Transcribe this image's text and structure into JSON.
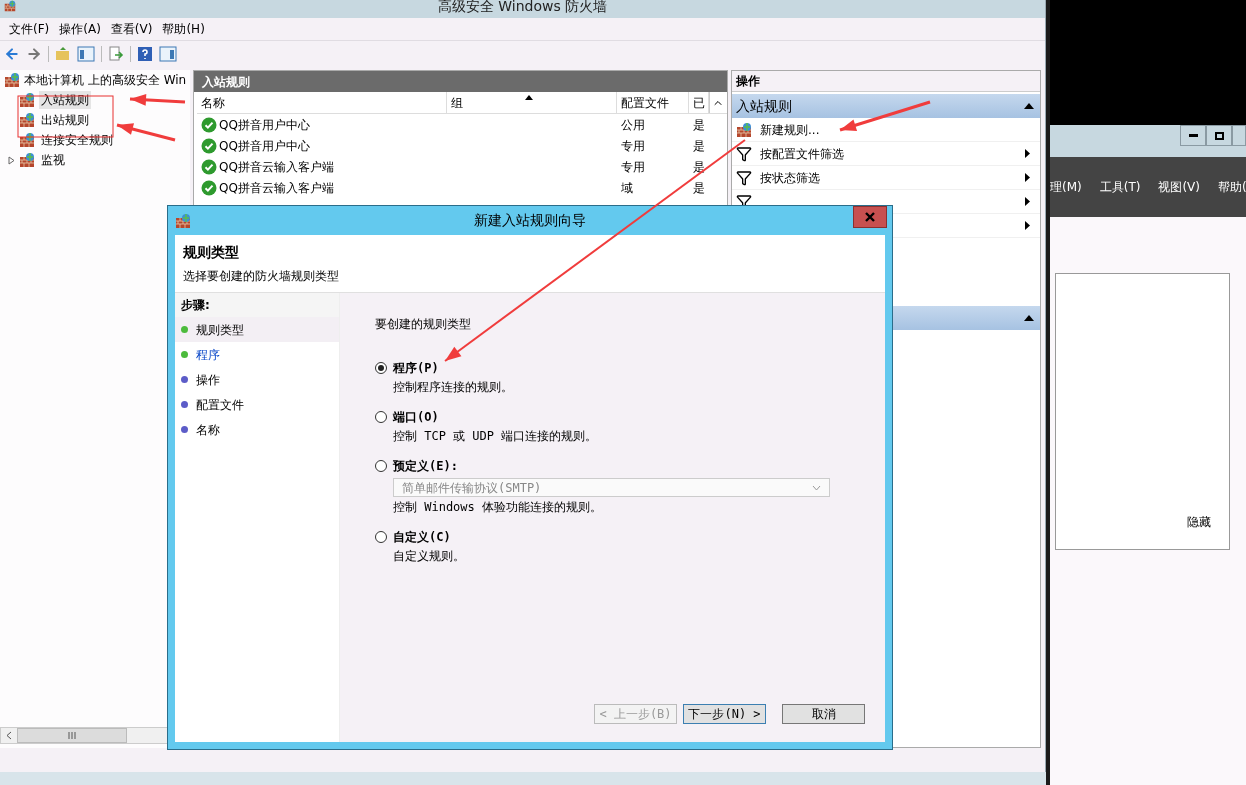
{
  "main_window": {
    "title": "高级安全 Windows 防火墙",
    "menu": [
      "文件(F)",
      "操作(A)",
      "查看(V)",
      "帮助(H)"
    ],
    "tree": {
      "root": "本地计算机 上的高级安全 Win",
      "children": [
        {
          "label": "入站规则",
          "kind": "leaf",
          "selected": true
        },
        {
          "label": "出站规则",
          "kind": "leaf",
          "selected": false
        },
        {
          "label": "连接安全规则",
          "kind": "leaf",
          "selected": false
        },
        {
          "label": "监视",
          "kind": "collapsed",
          "selected": false
        }
      ]
    },
    "center_pane": {
      "title": "入站规则",
      "columns": [
        "名称",
        "组",
        "配置文件",
        "已"
      ],
      "rows": [
        {
          "name": "QQ拼音用户中心",
          "profile": "公用",
          "enabled": "是"
        },
        {
          "name": "QQ拼音用户中心",
          "profile": "专用",
          "enabled": "是"
        },
        {
          "name": "QQ拼音云输入客户端",
          "profile": "专用",
          "enabled": "是"
        },
        {
          "name": "QQ拼音云输入客户端",
          "profile": "域",
          "enabled": "是"
        }
      ]
    },
    "actions_pane": {
      "title": "操作",
      "sections": [
        {
          "title": "入站规则",
          "expanded": true,
          "items": [
            {
              "label": "新建规则...",
              "kind": "new",
              "submenu": false
            },
            {
              "label": "按配置文件筛选",
              "kind": "filter",
              "submenu": true
            },
            {
              "label": "按状态筛选",
              "kind": "filter",
              "submenu": true
            },
            {
              "kind": "filter",
              "submenu": true
            },
            {
              "kind": "hidden",
              "submenu": true
            }
          ]
        },
        {
          "expanded": true
        }
      ]
    }
  },
  "dialog": {
    "title": "新建入站规则向导",
    "heading": "规则类型",
    "subheading": "选择要创建的防火墙规则类型",
    "steps_title": "步骤:",
    "steps": [
      {
        "label": "规则类型",
        "selected": true,
        "link": false,
        "color": "#4cbb3c"
      },
      {
        "label": "程序",
        "selected": false,
        "link": true,
        "color": "#4cbb3c"
      },
      {
        "label": "操作",
        "selected": false,
        "link": false,
        "color": "#5c5cc8"
      },
      {
        "label": "配置文件",
        "selected": false,
        "link": false,
        "color": "#5c5cc8"
      },
      {
        "label": "名称",
        "selected": false,
        "link": false,
        "color": "#5c5cc8"
      }
    ],
    "prompt": "要创建的规则类型",
    "options": [
      {
        "label": "程序(P)",
        "description": "控制程序连接的规则。",
        "selected": true
      },
      {
        "label": "端口(O)",
        "description": "控制 TCP 或 UDP 端口连接的规则。",
        "selected": false
      },
      {
        "label": "预定义(E):",
        "description": "控制 Windows 体验功能连接的规则。",
        "selected": false,
        "dropdown": {
          "value": "简单邮件传输协议(SMTP)",
          "disabled": true
        }
      },
      {
        "label": "自定义(C)",
        "description": "自定义规则。",
        "selected": false
      }
    ],
    "buttons": [
      {
        "label": "< 上一步(B)",
        "disabled": true,
        "default": false
      },
      {
        "label": "下一步(N) >",
        "disabled": false,
        "default": true
      },
      {
        "label": "取消",
        "disabled": false,
        "default": false
      }
    ]
  },
  "background_window": {
    "menu": [
      "理(M)",
      "工具(T)",
      "视图(V)",
      "帮助("
    ],
    "panel_text": "隐藏"
  }
}
